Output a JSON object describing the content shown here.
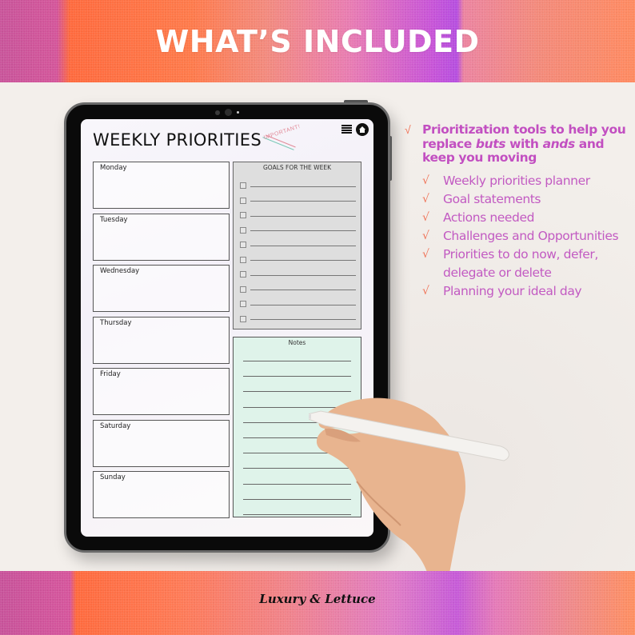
{
  "header": {
    "title": "WHAT’S INCLUDED"
  },
  "planner": {
    "title": "WEEKLY PRIORITIES",
    "stamp": "IMPORTANT!",
    "days": [
      "Monday",
      "Tuesday",
      "Wednesday",
      "Thursday",
      "Friday",
      "Saturday",
      "Sunday"
    ],
    "goals_heading": "GOALS FOR THE WEEK",
    "goal_rows": 10,
    "notes_heading": "Notes",
    "note_lines": 11,
    "icons": [
      "menu-icon",
      "home-icon"
    ]
  },
  "features": {
    "check_glyph": "√",
    "main": {
      "part1": "Prioritization tools to help you replace ",
      "em1": "buts",
      "part2": " with ",
      "em2": "ands",
      "part3": " and keep you moving"
    },
    "items": [
      "Weekly priorities planner",
      "Goal statements",
      "Actions needed",
      "Challenges and Opportunities",
      "Priorities to do now, defer, delegate or delete",
      "Planning your ideal day"
    ]
  },
  "footer": {
    "brand": "Luxury & Lettuce"
  },
  "colors": {
    "accent_text": "#c24fc1",
    "check": "#f07358",
    "notes_bg": "#dff3ea",
    "goals_bg": "#dedede"
  }
}
